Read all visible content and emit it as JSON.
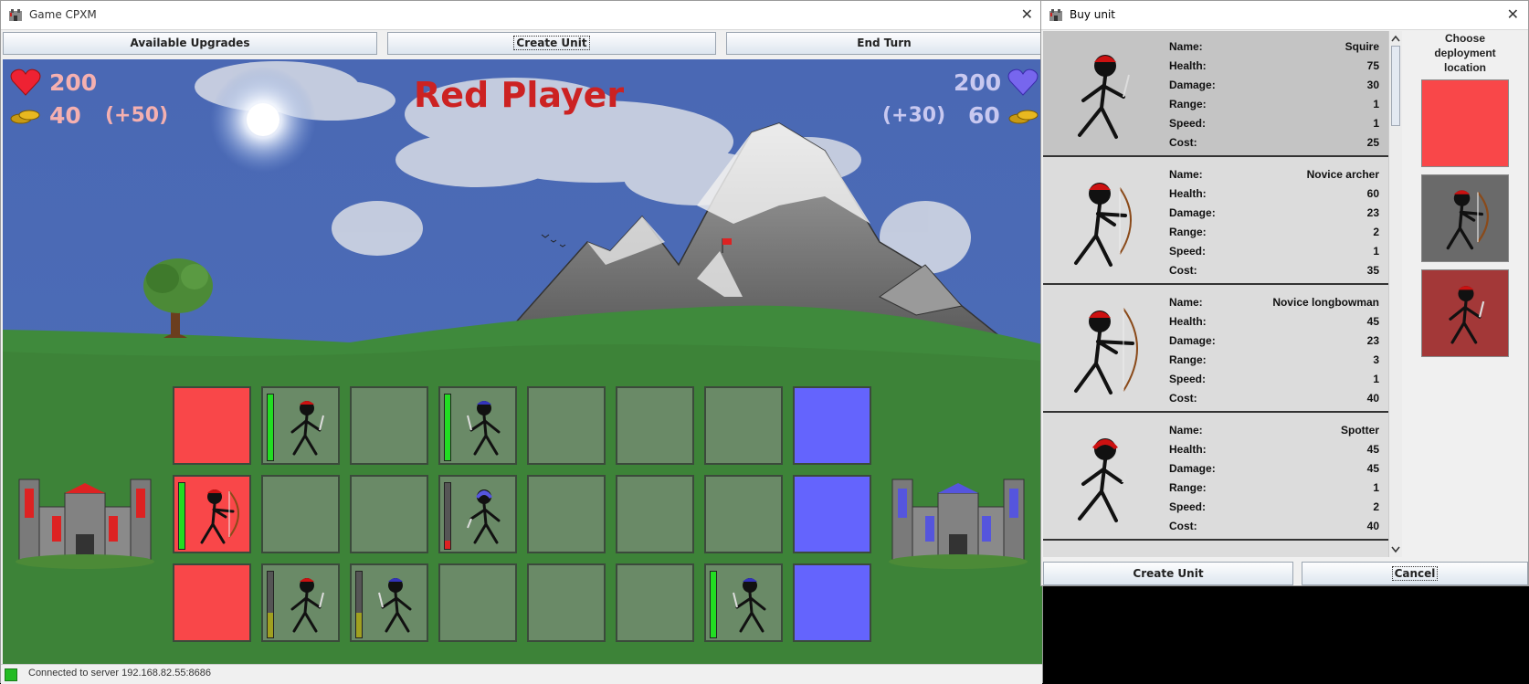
{
  "game_window": {
    "title": "Game CPXM",
    "close_glyph": "✕",
    "toolbar": {
      "upgrades_label": "Available Upgrades",
      "create_unit_label": "Create Unit",
      "end_turn_label": "End Turn"
    },
    "hud": {
      "current_player": "Red Player",
      "red": {
        "health": "200",
        "gold": "40",
        "income": "(+50)"
      },
      "blue": {
        "health": "200",
        "gold": "60",
        "income": "(+30)"
      }
    },
    "status_text": "Connected to server 192.168.82.55:8686",
    "colors": {
      "red_player": "#cc2222",
      "red_stat": "#f5b0b0",
      "blue_stat": "#c8c8f0",
      "red_zone": "#f94749",
      "blue_zone": "#6464fd",
      "hp_full": "#22dd22",
      "hp_low": "#a0a020"
    }
  },
  "buy_window": {
    "title": "Buy unit",
    "close_glyph": "✕",
    "deploy_heading": "Choose deployment location",
    "stat_labels": {
      "name": "Name:",
      "health": "Health:",
      "damage": "Damage:",
      "range": "Range:",
      "speed": "Speed:",
      "cost": "Cost:"
    },
    "units": [
      {
        "name": "Squire",
        "health": "75",
        "damage": "30",
        "range": "1",
        "speed": "1",
        "cost": "25"
      },
      {
        "name": "Novice archer",
        "health": "60",
        "damage": "23",
        "range": "2",
        "speed": "1",
        "cost": "35"
      },
      {
        "name": "Novice longbowman",
        "health": "45",
        "damage": "23",
        "range": "3",
        "speed": "1",
        "cost": "40"
      },
      {
        "name": "Spotter",
        "health": "45",
        "damage": "45",
        "range": "1",
        "speed": "2",
        "cost": "40"
      }
    ],
    "create_unit_label": "Create Unit",
    "cancel_label": "Cancel"
  },
  "icons": [
    "app-icon",
    "close-icon",
    "heart-icon",
    "coins-icon",
    "sun-icon",
    "castle-icon",
    "stickman-icon",
    "scroll-up-icon",
    "scroll-down-icon"
  ]
}
